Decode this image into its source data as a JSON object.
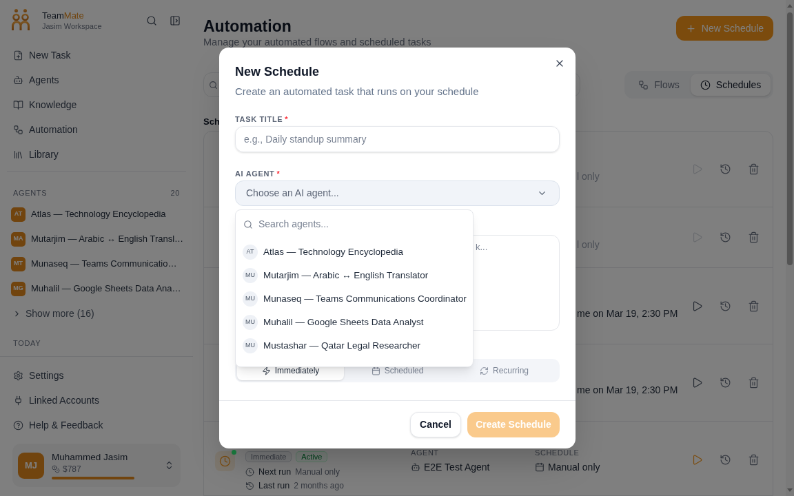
{
  "sidebar": {
    "brand": {
      "name": "Team",
      "accent": "Mate",
      "workspace": "Jasim Workspace"
    },
    "nav": [
      {
        "label": "New Task"
      },
      {
        "label": "Agents"
      },
      {
        "label": "Knowledge"
      },
      {
        "label": "Automation"
      },
      {
        "label": "Library"
      }
    ],
    "agents": {
      "title": "AGENTS",
      "count": "20",
      "items": [
        {
          "initials": "AT",
          "name": "Atlas — Technology Encyclopedia"
        },
        {
          "initials": "MA",
          "name": "Mutarjim — Arabic ↔ English Transl…"
        },
        {
          "initials": "MT",
          "name": "Munaseq — Teams Communicatio…"
        },
        {
          "initials": "MG",
          "name": "Muhalil — Google Sheets Data Ana…"
        }
      ],
      "show_more": "Show more (16)"
    },
    "history_label": "TODAY",
    "footer_nav": [
      {
        "label": "Settings"
      },
      {
        "label": "Linked Accounts"
      },
      {
        "label": "Help & Feedback"
      }
    ],
    "user": {
      "initials": "MJ",
      "name": "Muhammed Jasim",
      "credits": "$787",
      "level": 1
    }
  },
  "page": {
    "title": "Automation",
    "subtitle": "Manage your automated flows and scheduled tasks",
    "new_button": "New Schedule",
    "tabs": [
      {
        "label": "Flows",
        "selected": false
      },
      {
        "label": "Schedules",
        "selected": true
      }
    ],
    "section_heading": "Sch",
    "rows": [
      {
        "kind": "covered",
        "schedule": "l only",
        "enabled": false,
        "highlighted": false
      },
      {
        "kind": "covered",
        "schedule": "l only",
        "enabled": false,
        "highlighted": false
      },
      {
        "kind": "covered",
        "schedule": "me on Mar 19, 2:30 PM",
        "enabled": true,
        "highlighted": false
      },
      {
        "kind": "covered",
        "schedule": "me on Mar 19, 2:30 PM",
        "enabled": true,
        "highlighted": false
      },
      {
        "kind": "detail",
        "enabled": true,
        "highlighted": true,
        "color": "#17733a",
        "badges": [
          {
            "label": "Immediate",
            "kind": "type"
          },
          {
            "label": "Active",
            "kind": "status"
          }
        ],
        "runs": [
          {
            "label": "Next run",
            "value": "Manual only"
          },
          {
            "label": "Last run",
            "value": "2 months ago"
          }
        ],
        "agent_label": "AGENT",
        "agent": "E2E Test Agent",
        "schedule_label": "SCHEDULE",
        "schedule": "Manual only"
      }
    ]
  },
  "dialog": {
    "title": "New Schedule",
    "description": "Create an automated task that runs on your schedule",
    "task_title": {
      "label": "TASK TITLE",
      "required_mark": "*",
      "placeholder": "e.g., Daily standup summary"
    },
    "agent_select": {
      "label": "AI AGENT",
      "required_mark": "*",
      "placeholder": "Choose an AI agent...",
      "expanded": true,
      "search_placeholder": "Search agents...",
      "options": [
        {
          "initials": "AT",
          "name": "Atlas — Technology Encyclopedia"
        },
        {
          "initials": "MU",
          "name": "Mutarjim — Arabic ↔ English Translator"
        },
        {
          "initials": "MU",
          "name": "Munaseq — Teams Communications Coordinator"
        },
        {
          "initials": "MU",
          "name": "Muhalil — Google Sheets Data Analyst"
        },
        {
          "initials": "MU",
          "name": "Mustashar — Qatar Legal Researcher"
        }
      ]
    },
    "instructions": {
      "placeholder": "k..."
    },
    "run_modes": [
      {
        "label": "Immediately",
        "selected": true
      },
      {
        "label": "Scheduled",
        "selected": false
      },
      {
        "label": "Recurring",
        "selected": false
      }
    ],
    "buttons": [
      {
        "label": "Cancel",
        "kind": "secondary",
        "disabled": false
      },
      {
        "label": "Create Schedule",
        "kind": "primary",
        "disabled": true
      }
    ]
  }
}
